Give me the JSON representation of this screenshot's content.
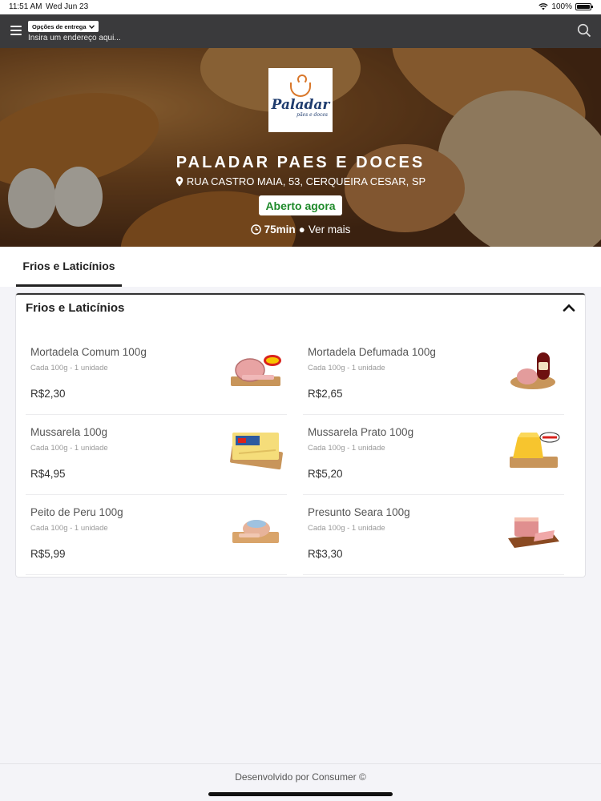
{
  "status_bar": {
    "time": "11:51 AM",
    "date": "Wed Jun 23",
    "battery": "100%",
    "battery_level": 1.0
  },
  "nav": {
    "delivery_label": "Opções de entrega",
    "address_placeholder": "Insira um endereço aqui..."
  },
  "store": {
    "logo_text": "Paladar",
    "logo_tagline": "pães e doces",
    "name": "PALADAR PAES E DOCES",
    "address": "RUA CASTRO MAIA, 53, CERQUEIRA CESAR, SP",
    "status": "Aberto agora",
    "eta": "75min",
    "more_label": "Ver mais",
    "status_color": "#1f8a2b"
  },
  "tabs": [
    {
      "label": "Frios e Laticínios"
    }
  ],
  "category": {
    "title": "Frios e Laticínios",
    "products": [
      {
        "name": "Mortadela Comum 100g",
        "desc": "Cada 100g - 1 unidade",
        "price": "R$2,30",
        "icon": "mortadela-comum"
      },
      {
        "name": "Mortadela Defumada 100g",
        "desc": "Cada 100g - 1 unidade",
        "price": "R$2,65",
        "icon": "mortadela-defumada"
      },
      {
        "name": "Mussarela 100g",
        "desc": "Cada 100g - 1 unidade",
        "price": "R$4,95",
        "icon": "mussarela"
      },
      {
        "name": "Mussarela Prato 100g",
        "desc": "Cada 100g - 1 unidade",
        "price": "R$5,20",
        "icon": "mussarela-prato"
      },
      {
        "name": "Peito de Peru 100g",
        "desc": "Cada 100g - 1 unidade",
        "price": "R$5,99",
        "icon": "peito-de-peru"
      },
      {
        "name": "Presunto Seara 100g",
        "desc": "Cada 100g - 1 unidade",
        "price": "R$3,30",
        "icon": "presunto"
      }
    ]
  },
  "footer": {
    "text": "Desenvolvido por Consumer ©"
  }
}
